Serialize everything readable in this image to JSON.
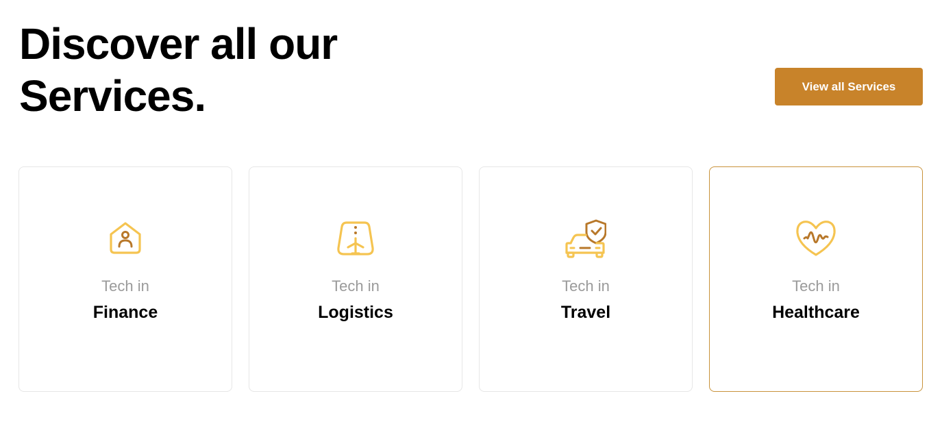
{
  "header": {
    "title_line1": "Discover all our",
    "title_line2": "Services."
  },
  "cta": {
    "label": "View all Services"
  },
  "colors": {
    "accent": "#c8832a",
    "icon_light": "#f5c451",
    "icon_dark": "#b8782a",
    "active_border": "#c8923a"
  },
  "services": [
    {
      "kicker": "Tech in",
      "title": "Finance",
      "icon": "house-person-icon"
    },
    {
      "kicker": "Tech in",
      "title": "Logistics",
      "icon": "airplane-runway-icon"
    },
    {
      "kicker": "Tech in",
      "title": "Travel",
      "icon": "car-shield-icon"
    },
    {
      "kicker": "Tech in",
      "title": "Healthcare",
      "icon": "heart-pulse-icon"
    }
  ]
}
